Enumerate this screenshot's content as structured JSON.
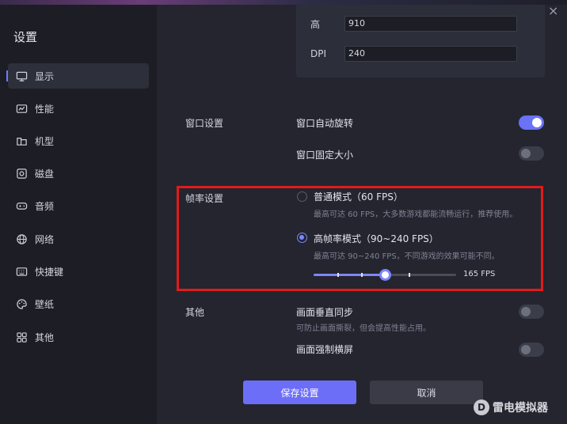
{
  "sidebar": {
    "title": "设置",
    "items": [
      {
        "label": "显示",
        "icon": "monitor-icon",
        "active": true
      },
      {
        "label": "性能",
        "icon": "performance-icon",
        "active": false
      },
      {
        "label": "机型",
        "icon": "device-model-icon",
        "active": false
      },
      {
        "label": "磁盘",
        "icon": "disk-icon",
        "active": false
      },
      {
        "label": "音频",
        "icon": "gamepad-icon",
        "active": false
      },
      {
        "label": "网络",
        "icon": "globe-icon",
        "active": false
      },
      {
        "label": "快捷键",
        "icon": "keyboard-icon",
        "active": false
      },
      {
        "label": "壁纸",
        "icon": "palette-icon",
        "active": false
      },
      {
        "label": "其他",
        "icon": "grid-icon",
        "active": false
      }
    ]
  },
  "close_glyph": "×",
  "resolution": {
    "height_label": "高",
    "height_value": "910",
    "dpi_label": "DPI",
    "dpi_value": "240"
  },
  "window_settings": {
    "section_label": "窗口设置",
    "auto_rotate_label": "窗口自动旋转",
    "auto_rotate_on": true,
    "fixed_size_label": "窗口固定大小",
    "fixed_size_on": false
  },
  "frame_rate": {
    "section_label": "帧率设置",
    "normal_label": "普通模式（60 FPS）",
    "normal_desc": "最高可达 60 FPS，大多数游戏都能流畅运行，推荐使用。",
    "normal_selected": false,
    "high_label": "高帧率模式（90~240 FPS）",
    "high_desc": "最高可达 90~240 FPS，不同游戏的效果可能不同。",
    "high_selected": true,
    "fps_value": "165 FPS",
    "slider_min": 90,
    "slider_max": 240,
    "slider_current": 165
  },
  "other": {
    "section_label": "其他",
    "vsync_label": "画面垂直同步",
    "vsync_desc": "可防止画面撕裂，但会提高性能占用。",
    "vsync_on": false,
    "force_landscape_label": "画面强制横屏",
    "force_landscape_on": false
  },
  "actions": {
    "save_label": "保存设置",
    "cancel_label": "取消"
  },
  "watermark": {
    "logo_glyph": "D",
    "text": "雷电模拟器"
  },
  "colors": {
    "accent": "#6d6ef8",
    "highlight_box": "#e11b1b"
  }
}
